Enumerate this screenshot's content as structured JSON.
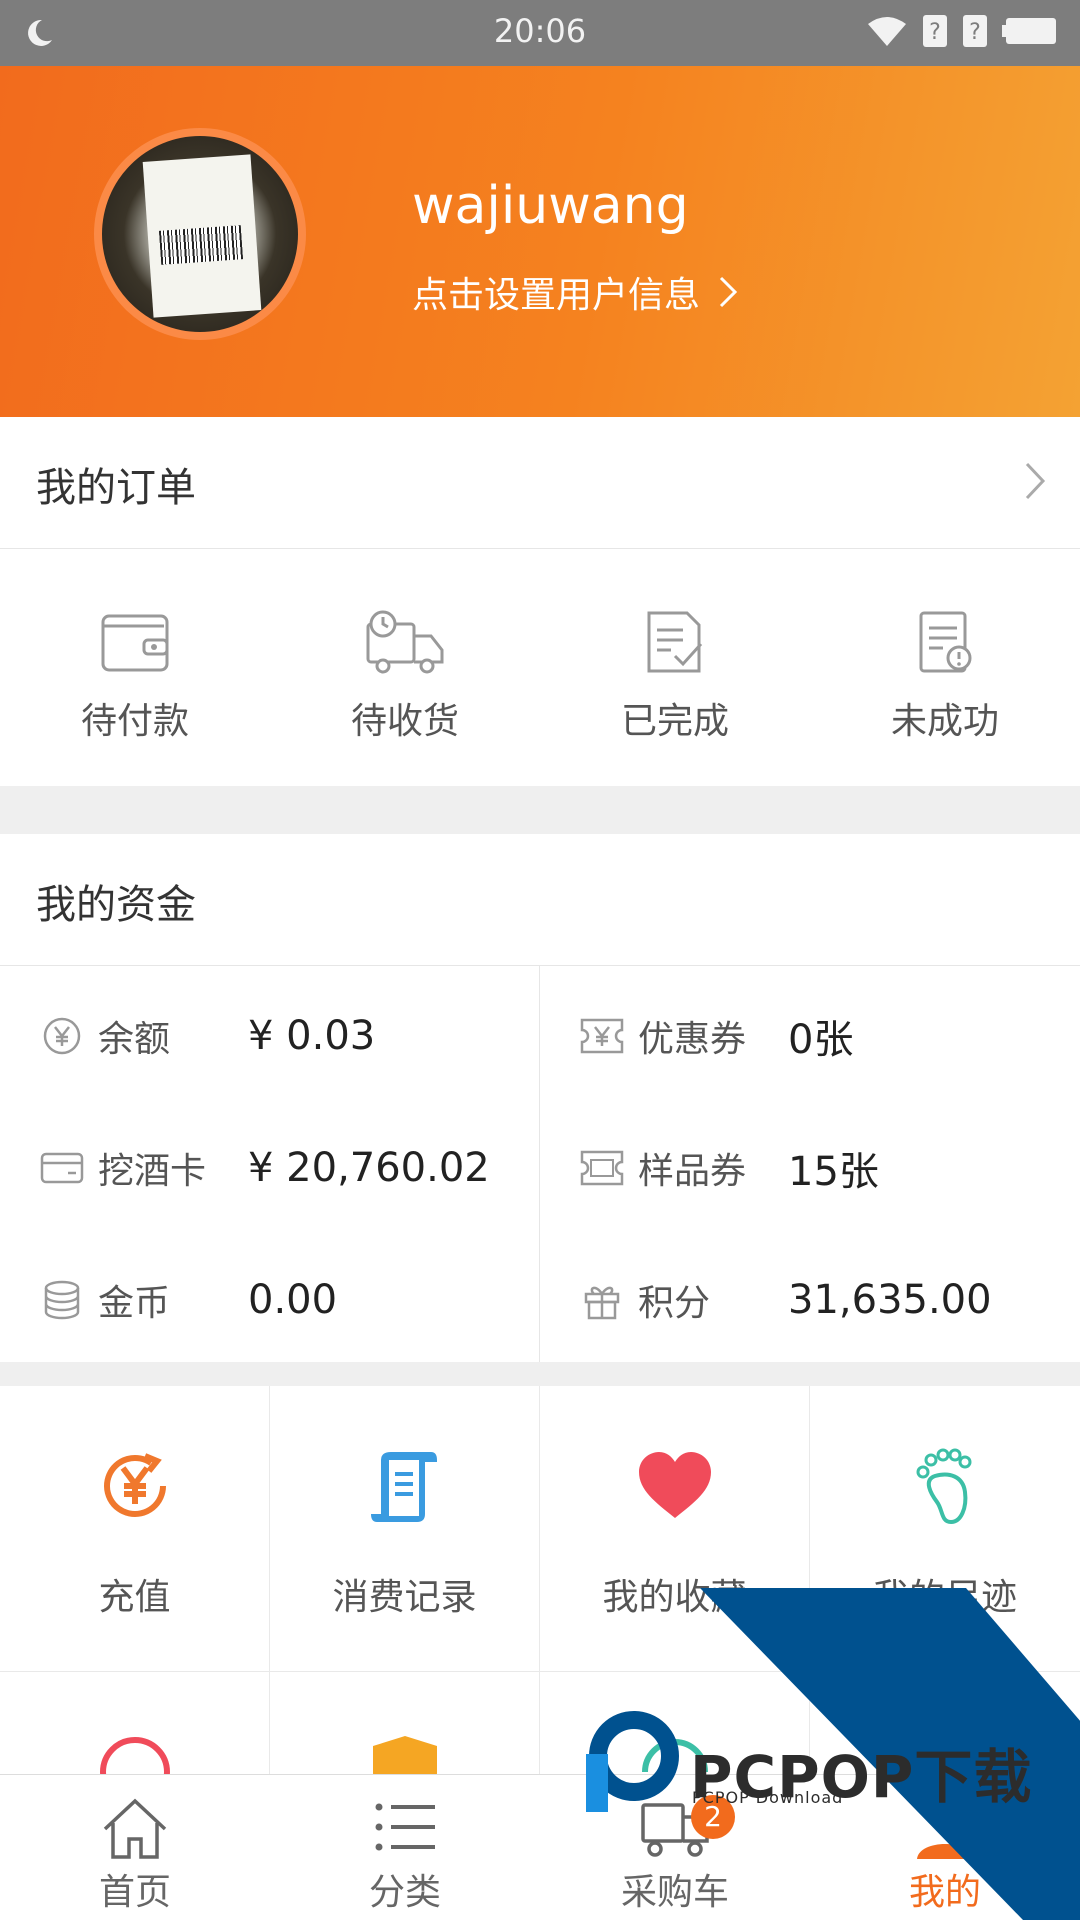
{
  "status_bar": {
    "time": "20:06"
  },
  "profile": {
    "username": "wajiuwang",
    "set_info": "点击设置用户信息"
  },
  "orders": {
    "title": "我的订单",
    "items": [
      {
        "label": "待付款",
        "icon": "wallet-icon"
      },
      {
        "label": "待收货",
        "icon": "truck-icon"
      },
      {
        "label": "已完成",
        "icon": "doc-check-icon"
      },
      {
        "label": "未成功",
        "icon": "doc-alert-icon"
      }
    ]
  },
  "funds": {
    "title": "我的资金",
    "items": [
      {
        "label": "余额",
        "value": "¥ 0.03",
        "icon": "yen-circle-icon"
      },
      {
        "label": "优惠券",
        "value": "0张",
        "icon": "coupon-icon"
      },
      {
        "label": "挖酒卡",
        "value": "¥ 20,760.02",
        "icon": "card-icon"
      },
      {
        "label": "样品券",
        "value": "15张",
        "icon": "sample-ticket-icon"
      },
      {
        "label": "金币",
        "value": "0.00",
        "icon": "coins-icon"
      },
      {
        "label": "积分",
        "value": "31,635.00",
        "icon": "gift-icon"
      }
    ]
  },
  "services": {
    "items": [
      {
        "label": "充值",
        "icon": "recharge-icon",
        "color": "#f0782d"
      },
      {
        "label": "消费记录",
        "icon": "receipt-icon",
        "color": "#3a9be0"
      },
      {
        "label": "我的收藏",
        "icon": "heart-icon",
        "color": "#f04b5a"
      },
      {
        "label": "我的足迹",
        "icon": "footprint-icon",
        "color": "#3cbfa6"
      },
      {
        "label": "",
        "icon": "lottery-icon",
        "color": "#f04b5a"
      },
      {
        "label": "",
        "icon": "shield-yen-icon",
        "color": "#f5a623"
      },
      {
        "label": "",
        "icon": "service-icon",
        "color": "#3cbfa6"
      },
      {
        "label": "",
        "icon": "blank",
        "color": "#ffffff"
      }
    ]
  },
  "tabbar": {
    "tabs": [
      {
        "label": "首页",
        "icon": "home-icon"
      },
      {
        "label": "分类",
        "icon": "list-icon"
      },
      {
        "label": "采购车",
        "icon": "cart-icon",
        "badge": "2"
      },
      {
        "label": "我的",
        "icon": "user-icon"
      }
    ]
  },
  "watermark": {
    "brand": "PCPOP下载",
    "sub": "PCPOP Download"
  },
  "colors": {
    "accent": "#f26b1d",
    "header_end": "#f4a233",
    "watermark_blue": "#00518f"
  }
}
